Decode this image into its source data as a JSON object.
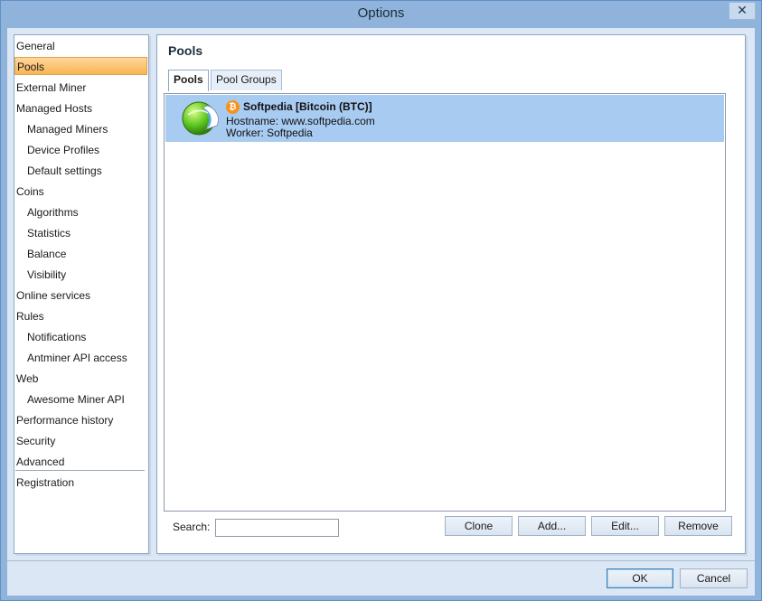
{
  "window": {
    "title": "Options",
    "close_glyph": "✕"
  },
  "nav": {
    "items": [
      {
        "label": "General",
        "level": 0
      },
      {
        "label": "Pools",
        "level": 0,
        "selected": true
      },
      {
        "label": "External Miner",
        "level": 0
      },
      {
        "label": "Managed Hosts",
        "level": 0
      },
      {
        "label": "Managed Miners",
        "level": 1
      },
      {
        "label": "Device Profiles",
        "level": 1
      },
      {
        "label": "Default settings",
        "level": 1
      },
      {
        "label": "Coins",
        "level": 0
      },
      {
        "label": "Algorithms",
        "level": 1
      },
      {
        "label": "Statistics",
        "level": 1
      },
      {
        "label": "Balance",
        "level": 1
      },
      {
        "label": "Visibility",
        "level": 1
      },
      {
        "label": "Online services",
        "level": 0
      },
      {
        "label": "Rules",
        "level": 0
      },
      {
        "label": "Notifications",
        "level": 1
      },
      {
        "label": "Antminer API access",
        "level": 1
      },
      {
        "label": "Web",
        "level": 0
      },
      {
        "label": "Awesome Miner API",
        "level": 1
      },
      {
        "label": "Performance history",
        "level": 0
      },
      {
        "label": "Security",
        "level": 0
      },
      {
        "label": "Advanced",
        "level": 0
      },
      {
        "label": "Registration",
        "level": 0
      }
    ]
  },
  "panel": {
    "title": "Pools",
    "tabs": [
      {
        "label": "Pools",
        "active": true
      },
      {
        "label": "Pool Groups",
        "active": false
      }
    ],
    "pools": [
      {
        "name": "Softpedia [Bitcoin (BTC)]",
        "hostname": "Hostname: www.softpedia.com",
        "worker": "Worker: Softpedia",
        "coin_icon": "bitcoin-icon",
        "pool_icon": "pool-globe-icon"
      }
    ],
    "search": {
      "label": "Search:",
      "value": ""
    },
    "buttons": {
      "clone": "Clone",
      "add": "Add...",
      "edit": "Edit...",
      "remove": "Remove"
    }
  },
  "footer": {
    "ok": "OK",
    "cancel": "Cancel"
  },
  "colors": {
    "title_bar": "#8fb3da",
    "selected_nav": "#f7b554",
    "selected_row": "#a8cbf1",
    "btc": "#f7931a"
  }
}
